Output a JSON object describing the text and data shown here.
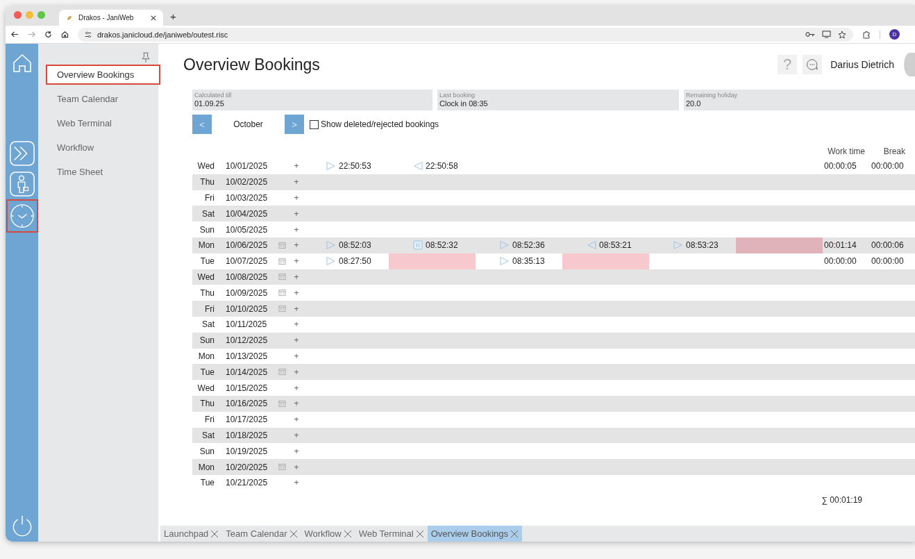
{
  "browser": {
    "tab_title": "Drakos - JaniWeb",
    "new_tab": "+",
    "url": "drakos.janicloud.de/janiweb/outest.risc",
    "profile_initial": "D"
  },
  "rail": [
    {
      "kind": "home",
      "selected": false
    },
    {
      "kind": "terminal",
      "selected": false
    },
    {
      "kind": "person",
      "selected": false
    },
    {
      "kind": "clock",
      "selected": true
    },
    {
      "kind": "power",
      "selected": false
    }
  ],
  "sidebar": {
    "items": [
      {
        "label": "Overview Bookings",
        "selected": true
      },
      {
        "label": "Team Calendar",
        "selected": false
      },
      {
        "label": "Web Terminal",
        "selected": false
      },
      {
        "label": "Workflow",
        "selected": false
      },
      {
        "label": "Time Sheet",
        "selected": false
      }
    ]
  },
  "header": {
    "title": "Overview Bookings",
    "help": "?",
    "user": "Darius Dietrich"
  },
  "info": [
    {
      "label": "Calculated till",
      "value": "01.09.25"
    },
    {
      "label": "Last booking",
      "value": "Clock in 08:35"
    },
    {
      "label": "Remaining holiday",
      "value": "20.0"
    }
  ],
  "nav": {
    "prev": "<",
    "month": "October",
    "next": ">",
    "show_deleted": {
      "label": "Show deleted/rejected bookings",
      "checked": false
    }
  },
  "columns": [
    "Work time",
    "Break"
  ],
  "rows": [
    {
      "day": "Wed",
      "date": "10/01/2025",
      "note": false,
      "add": "+",
      "bookings": [
        {
          "kind": "in",
          "time": "22:50:53"
        },
        {
          "kind": "out",
          "time": "22:50:58"
        }
      ],
      "work_time": "00:00:05",
      "break": "00:00:00"
    },
    {
      "day": "Thu",
      "date": "10/02/2025",
      "note": false,
      "add": "+",
      "bookings": []
    },
    {
      "day": "Fri",
      "date": "10/03/2025",
      "note": false,
      "add": "+",
      "bookings": []
    },
    {
      "day": "Sat",
      "date": "10/04/2025",
      "note": false,
      "add": "+",
      "bookings": []
    },
    {
      "day": "Sun",
      "date": "10/05/2025",
      "note": false,
      "add": "+",
      "bookings": []
    },
    {
      "day": "Mon",
      "date": "10/06/2025",
      "note": true,
      "add": "+",
      "bookings": [
        {
          "kind": "in",
          "time": "08:52:03"
        },
        {
          "kind": "break",
          "time": "08:52:32"
        },
        {
          "kind": "in",
          "time": "08:52:36"
        },
        {
          "kind": "out",
          "time": "08:53:21"
        },
        {
          "kind": "in",
          "time": "08:53:23"
        },
        {
          "kind": "missing",
          "color": "#e0b3ba"
        }
      ],
      "work_time": "00:01:14",
      "break": "00:00:06"
    },
    {
      "day": "Tue",
      "date": "10/07/2025",
      "note": true,
      "add": "+",
      "bookings": [
        {
          "kind": "in",
          "time": "08:27:50"
        },
        {
          "kind": "missing",
          "color": "#f7c9cf"
        },
        {
          "kind": "in",
          "time": "08:35:13"
        },
        {
          "kind": "missing",
          "color": "#f7c9cf"
        }
      ],
      "work_time": "00:00:00",
      "break": "00:00:00"
    },
    {
      "day": "Wed",
      "date": "10/08/2025",
      "note": true,
      "add": "+",
      "bookings": []
    },
    {
      "day": "Thu",
      "date": "10/09/2025",
      "note": true,
      "add": "+",
      "bookings": []
    },
    {
      "day": "Fri",
      "date": "10/10/2025",
      "note": true,
      "add": "+",
      "bookings": []
    },
    {
      "day": "Sat",
      "date": "10/11/2025",
      "note": false,
      "add": "+",
      "bookings": []
    },
    {
      "day": "Sun",
      "date": "10/12/2025",
      "note": false,
      "add": "+",
      "bookings": []
    },
    {
      "day": "Mon",
      "date": "10/13/2025",
      "note": false,
      "add": "+",
      "bookings": []
    },
    {
      "day": "Tue",
      "date": "10/14/2025",
      "note": true,
      "add": "+",
      "bookings": []
    },
    {
      "day": "Wed",
      "date": "10/15/2025",
      "note": false,
      "add": "+",
      "bookings": []
    },
    {
      "day": "Thu",
      "date": "10/16/2025",
      "note": true,
      "add": "+",
      "bookings": []
    },
    {
      "day": "Fri",
      "date": "10/17/2025",
      "note": false,
      "add": "+",
      "bookings": []
    },
    {
      "day": "Sat",
      "date": "10/18/2025",
      "note": false,
      "add": "+",
      "bookings": []
    },
    {
      "day": "Sun",
      "date": "10/19/2025",
      "note": false,
      "add": "+",
      "bookings": []
    },
    {
      "day": "Mon",
      "date": "10/20/2025",
      "note": true,
      "add": "+",
      "bookings": []
    },
    {
      "day": "Tue",
      "date": "10/21/2025",
      "note": false,
      "add": "+",
      "bookings": []
    }
  ],
  "total": "∑ 00:01:19",
  "tabs": [
    {
      "label": "Launchpad",
      "selected": false
    },
    {
      "label": "Team Calendar",
      "selected": false
    },
    {
      "label": "Workflow",
      "selected": false
    },
    {
      "label": "Web Terminal",
      "selected": false
    },
    {
      "label": "Overview Bookings",
      "selected": true
    }
  ]
}
